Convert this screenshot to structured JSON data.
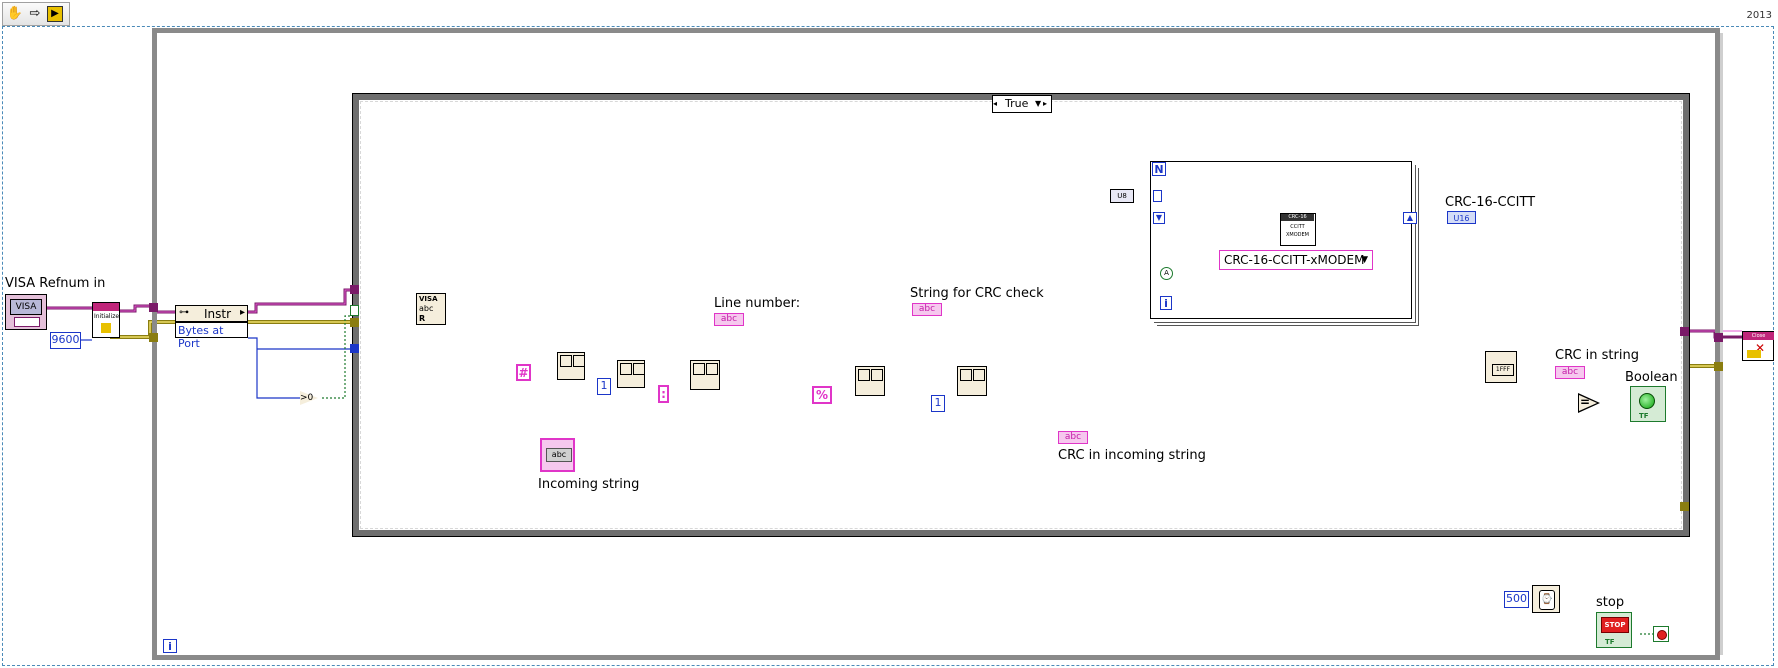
{
  "toolbar": {
    "run_continuously_icon": "hand-icon",
    "arrow_icon": "arrow-icon",
    "run_icon": "run-icon"
  },
  "version": "2013",
  "case_selector": {
    "value": "True"
  },
  "controls": {
    "visa_refnum_label": "VISA Refnum in",
    "visa_terminal_text": "VISA",
    "baud_rate": "9600",
    "visa_class": "Instr",
    "property": "Bytes at Port",
    "delimiter_hash": "#",
    "delimiter_percent": "%",
    "delimiter_colon": ":",
    "const_one_a": "1",
    "const_one_b": "1",
    "wait_ms": "500"
  },
  "nodes": {
    "serial_init_text": "Initialize",
    "visa_read_text": "VISA",
    "visa_read_mode": "R",
    "visa_close_text": "Close",
    "crc_node_title": "CRC-16",
    "crc_node_line1": "CCITT",
    "crc_node_line2": "XMODEM",
    "crc_ring_value": "CRC-16-CCITT-xMODEM",
    "u8_label": "U8",
    "abc_text": "abc",
    "u16_text": "U16",
    "tf_text": "TF",
    "stop_text": "STOP",
    "n_text": "N",
    "i_text": "i",
    "compare_eq": "=",
    "compare_gt": ">0"
  },
  "indicators": {
    "line_number": "Line number:",
    "incoming_string": "Incoming string",
    "string_for_crc": "String for CRC check",
    "crc_in_incoming": "CRC in incoming string",
    "crc_16_ccitt": "CRC-16-CCITT",
    "crc_in_string": "CRC in string",
    "boolean": "Boolean",
    "stop": "stop"
  },
  "colors": {
    "string_wire": "#e035c8",
    "refnum_wire": "#7a1a68",
    "numeric_wire": "#1b36c8",
    "error_wire": "#a89a1c",
    "bool_wire": "#1d7a2d"
  }
}
